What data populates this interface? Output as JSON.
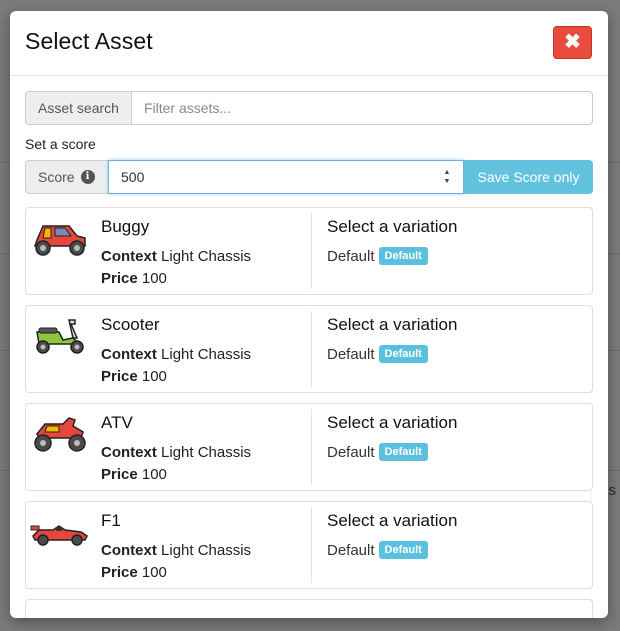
{
  "modal": {
    "title": "Select Asset",
    "close_label": "✖"
  },
  "search": {
    "addon_label": "Asset search",
    "placeholder": "Filter assets..."
  },
  "score": {
    "section_label": "Set a score",
    "addon_label": "Score",
    "info_glyph": "i",
    "value": "500",
    "save_button_label": "Save Score only"
  },
  "labels": {
    "context": "Context",
    "price": "Price",
    "select_variation": "Select a variation"
  },
  "assets": [
    {
      "name": "Buggy",
      "context": "Light Chassis",
      "price": "100",
      "variation": "Default",
      "badge": "Default",
      "icon": "buggy-icon"
    },
    {
      "name": "Scooter",
      "context": "Light Chassis",
      "price": "100",
      "variation": "Default",
      "badge": "Default",
      "icon": "scooter-icon"
    },
    {
      "name": "ATV",
      "context": "Light Chassis",
      "price": "100",
      "variation": "Default",
      "badge": "Default",
      "icon": "atv-icon"
    },
    {
      "name": "F1",
      "context": "Light Chassis",
      "price": "100",
      "variation": "Default",
      "badge": "Default",
      "icon": "f1-car-icon"
    }
  ],
  "background": {
    "partial_text": "s"
  },
  "colors": {
    "danger": "#e74c3c",
    "info": "#5bc0de",
    "focus": "#66afe9"
  }
}
